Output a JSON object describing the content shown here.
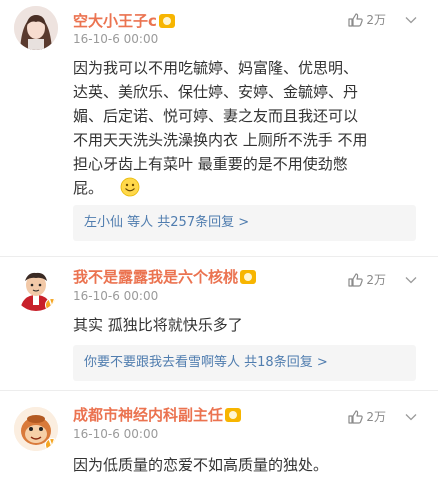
{
  "comments": [
    {
      "username": "空大小王子c",
      "time": "16-10-6 00:00",
      "likes": "2万",
      "lines": [
        "因为我可以不用吃毓婷、妈富隆、优思明、",
        "达英、美欣乐、保仕婷、安婷、金毓婷、丹",
        "媚、后定诺、悦可婷、妻之友而且我还可以",
        "不用天天洗头洗澡换内衣 上厕所不洗手 不用",
        "担心牙齿上有菜叶 最重要的是不用使劲憋",
        "屁。"
      ],
      "replies_who": "左小仙",
      "replies_tail": " 等人 ",
      "replies_count": "共257条回复 >"
    },
    {
      "username": "我不是露露我是六个核桃",
      "time": "16-10-6 00:00",
      "likes": "2万",
      "lines": [
        "其实 孤独比将就快乐多了"
      ],
      "replies_who": "你要不要跟我去看雪啊",
      "replies_tail": "等人 ",
      "replies_count": "共18条回复 >"
    },
    {
      "username": "成都市神经内科副主任",
      "time": "16-10-6 00:00",
      "likes": "2万",
      "lines": [
        "因为低质量的恋爱不如高质量的独处。"
      ]
    }
  ],
  "icons": {
    "like": "thumbs-up-icon",
    "more": "chevron-down-icon",
    "emoji": "smile-emoji-icon"
  },
  "colors": {
    "username": "#eb7350",
    "link": "#507daf",
    "meta": "#9a9a9a",
    "reply_bg": "#f5f5f5"
  }
}
